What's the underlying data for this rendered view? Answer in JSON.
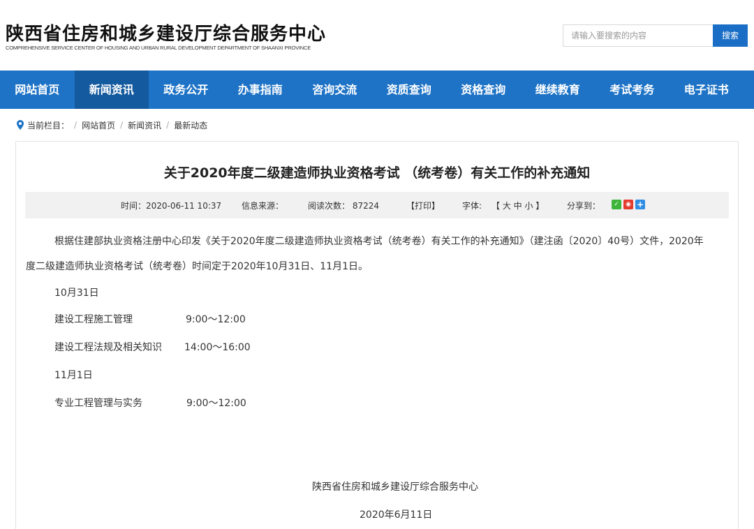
{
  "header": {
    "title_cn": "陕西省住房和城乡建设厅综合服务中心",
    "title_en": "COMPREHENSIVE SERVICE CENTER OF HOUSING AND URBAN RURAL DEVELOPMENT DEPARTMENT OF SHAANXI PROVINCE",
    "search_placeholder": "请输入要搜索的内容",
    "search_button": "搜索"
  },
  "nav": {
    "items": [
      {
        "label": "网站首页"
      },
      {
        "label": "新闻资讯",
        "active": true
      },
      {
        "label": "政务公开"
      },
      {
        "label": "办事指南"
      },
      {
        "label": "咨询交流"
      },
      {
        "label": "资质查询"
      },
      {
        "label": "资格查询"
      },
      {
        "label": "继续教育"
      },
      {
        "label": "考试考务"
      },
      {
        "label": "电子证书"
      }
    ]
  },
  "breadcrumb": {
    "prefix": "当前栏目：",
    "items": [
      "网站首页",
      "新闻资讯",
      "最新动态"
    ]
  },
  "article": {
    "title": "关于2020年度二级建造师执业资格考试 （统考卷）有关工作的补充通知",
    "meta": {
      "time": "时间：2020-06-11 10:37",
      "source": "信息来源：",
      "reads": "阅读次数： 87224",
      "print": "【打印】",
      "font_label": "字体:",
      "font_sizes": "【 大  中  小 】",
      "share_label": "分享到："
    },
    "para1_line1": "根据住建部执业资格注册中心印发《关于2020年度二级建造师执业资格考试（统考卷）有关工作的补充通知》（建注函〔2020〕40号）文件，2020年",
    "para1_line2": "度二级建造师执业资格考试（统考卷）时间定于2020年10月31日、11月1日。",
    "date1": "10月31日",
    "subject1": "建设工程施工管理",
    "time1": "9:00～12:00",
    "subject2": "建设工程法规及相关知识",
    "time2": "14:00～16:00",
    "date2": "11月1日",
    "subject3": "专业工程管理与实务",
    "time3": "9:00～12:00",
    "signature": "陕西省住房和城乡建设厅综合服务中心",
    "sign_date": "2020年6月11日"
  },
  "colors": {
    "nav_bg": "#1e73c6",
    "nav_active": "#145a9f",
    "search_btn": "#1a6ec5"
  }
}
